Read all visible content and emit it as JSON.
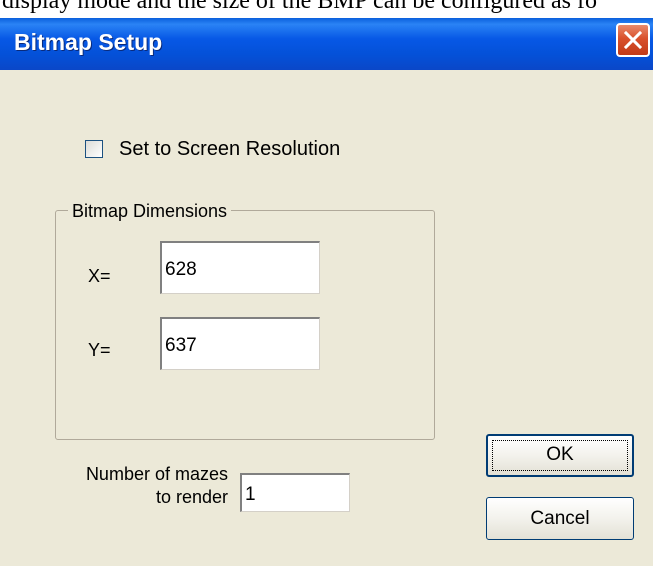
{
  "caption_text": "display mode and the size of the BMP can be configured as fo",
  "dialog": {
    "title": "Bitmap Setup"
  },
  "checkbox": {
    "label": "Set to Screen Resolution",
    "checked": false
  },
  "dimensions": {
    "group_title": "Bitmap Dimensions",
    "x_label": "X=",
    "x_value": "628",
    "y_label": "Y=",
    "y_value": "637"
  },
  "mazes": {
    "label_line1": "Number of mazes",
    "label_line2": "to render",
    "value": "1"
  },
  "buttons": {
    "ok_label": "OK",
    "cancel_label": "Cancel"
  },
  "icons": {
    "close": "close-icon"
  },
  "colors": {
    "titlebar": "#0758e6",
    "dialog_bg": "#ece9d8",
    "close_button": "#d9502b"
  }
}
